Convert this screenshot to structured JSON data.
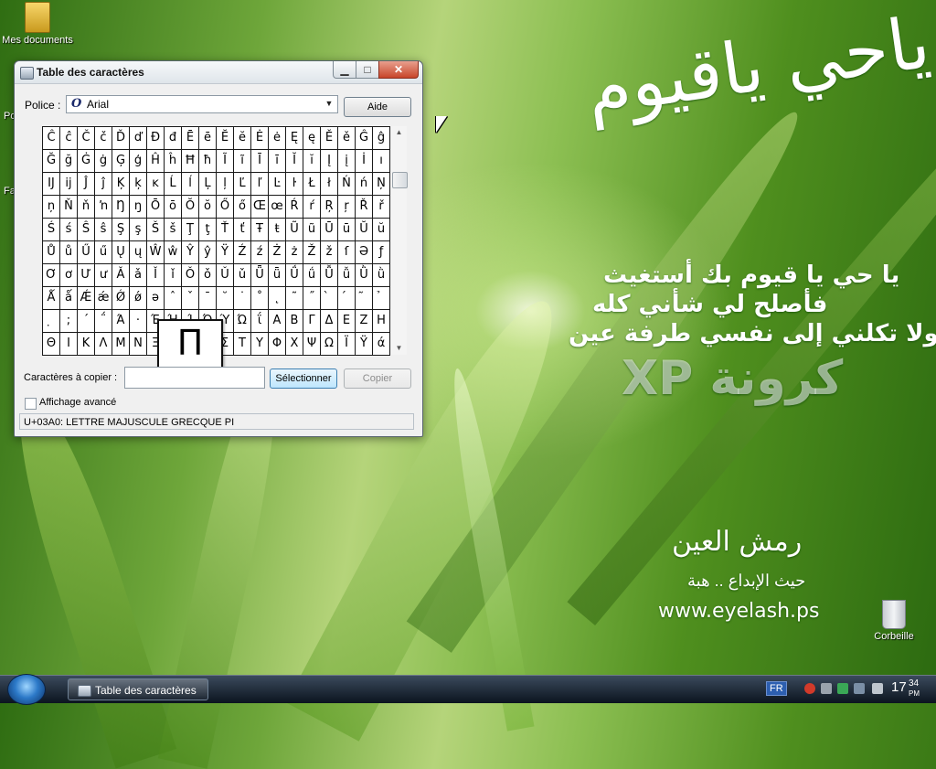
{
  "desktop": {
    "icons": [
      {
        "label": "Mes documents"
      },
      {
        "label": "Corbeille"
      }
    ],
    "partial_labels": [
      "Po",
      "Fa"
    ],
    "wallpaper_text": {
      "calligraphy": "ياحي ياقيوم",
      "lines": [
        "يا حي يا قيوم بك أستغيث",
        "فأصلح لي شأني كله",
        "ولا تكلني إلى نفسي طرفة عين"
      ],
      "brand": "كرونة XP",
      "logo": "رمش العين",
      "slogan": "حيث الإبداع .. هبة",
      "url": "www.eyelash.ps"
    }
  },
  "window": {
    "title": "Table des caractères",
    "controls": {
      "minimize": "▁",
      "maximize": "□",
      "close": "✕"
    },
    "font_label": "Police :",
    "font_value": "Arial",
    "help_button": "Aide",
    "characters": [
      "Ĉ",
      "ĉ",
      "Č",
      "č",
      "Ď",
      "ď",
      "Đ",
      "đ",
      "Ē",
      "ē",
      "Ĕ",
      "ĕ",
      "Ė",
      "ė",
      "Ę",
      "ę",
      "Ě",
      "ě",
      "Ĝ",
      "ĝ",
      "Ğ",
      "ğ",
      "Ġ",
      "ġ",
      "Ģ",
      "ģ",
      "Ĥ",
      "ĥ",
      "Ħ",
      "ħ",
      "Ĩ",
      "ĩ",
      "Ī",
      "ī",
      "Ĭ",
      "ĭ",
      "Į",
      "į",
      "İ",
      "ı",
      "Ĳ",
      "ĳ",
      "Ĵ",
      "ĵ",
      "Ķ",
      "ķ",
      "ĸ",
      "Ĺ",
      "ĺ",
      "Ļ",
      "ļ",
      "Ľ",
      "ľ",
      "Ŀ",
      "ŀ",
      "Ł",
      "ł",
      "Ń",
      "ń",
      "Ņ",
      "ņ",
      "Ň",
      "ň",
      "ŉ",
      "Ŋ",
      "ŋ",
      "Ō",
      "ō",
      "Ŏ",
      "ŏ",
      "Ő",
      "ő",
      "Œ",
      "œ",
      "Ŕ",
      "ŕ",
      "Ŗ",
      "ŗ",
      "Ř",
      "ř",
      "Ś",
      "ś",
      "Ŝ",
      "ŝ",
      "Ş",
      "ş",
      "Š",
      "š",
      "Ţ",
      "ţ",
      "Ť",
      "ť",
      "Ŧ",
      "ŧ",
      "Ũ",
      "ũ",
      "Ū",
      "ū",
      "Ŭ",
      "ŭ",
      "Ů",
      "ů",
      "Ű",
      "ű",
      "Ų",
      "ų",
      "Ŵ",
      "ŵ",
      "Ŷ",
      "ŷ",
      "Ÿ",
      "Ź",
      "ź",
      "Ż",
      "ż",
      "Ž",
      "ž",
      "ſ",
      "Ə",
      "ƒ",
      "Ơ",
      "ơ",
      "Ư",
      "ư",
      "Ǎ",
      "ǎ",
      "Ǐ",
      "ǐ",
      "Ǒ",
      "ǒ",
      "Ǔ",
      "ǔ",
      "Ǖ",
      "ǖ",
      "Ǘ",
      "ǘ",
      "Ǚ",
      "ǚ",
      "Ǜ",
      "ǜ",
      "Ǻ",
      "ǻ",
      "Ǽ",
      "ǽ",
      "Ǿ",
      "ǿ",
      "ə",
      "ˆ",
      "ˇ",
      "ˉ",
      "˘",
      "˙",
      "˚",
      "˛",
      "˜",
      "˝",
      "̀",
      "́",
      "̃",
      "̉",
      "̣",
      ";",
      "΄",
      "΅",
      "Ά",
      "·",
      "Έ",
      "Ή",
      "Ί",
      "Ό",
      "Ύ",
      "Ώ",
      "ΐ",
      "Α",
      "Β",
      "Γ",
      "Δ",
      "Ε",
      "Ζ",
      "Η",
      "Θ",
      "Ι",
      "Κ",
      "Λ",
      "Μ",
      "Ν",
      "Ξ",
      "Ο",
      "Π",
      "Ρ",
      "Σ",
      "Τ",
      "Υ",
      "Φ",
      "Χ",
      "Ψ",
      "Ω",
      "Ϊ",
      "Ϋ",
      "ά"
    ],
    "selected_char": "Π",
    "copy_label": "Caractères à copier :",
    "copy_value": "",
    "select_button": "Sélectionner",
    "copy_button": "Copier",
    "advanced_label": "Affichage avancé",
    "advanced_checked": false,
    "status_text": "U+03A0: LETTRE MAJUSCULE GRECQUE PI"
  },
  "taskbar": {
    "task_label": "Table des caractères",
    "language": "FR",
    "clock_hour": "17",
    "clock_minutes": "34",
    "clock_ampm": "PM"
  },
  "colors": {
    "selection_accent": "#3c7fb1",
    "close_button": "#c8452a",
    "taskbar": "#0b141f"
  }
}
